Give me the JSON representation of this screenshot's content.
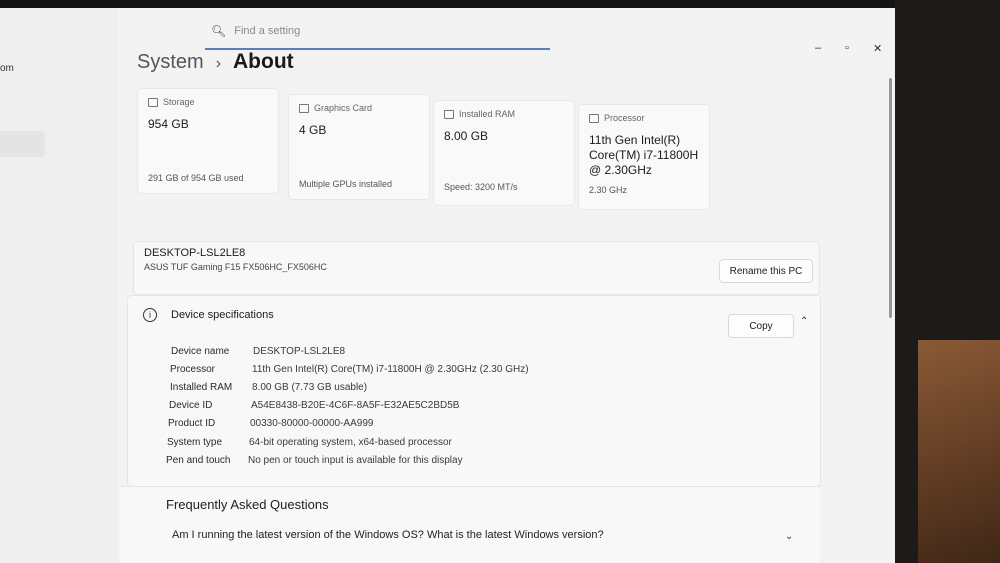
{
  "left_pane": {
    "fragment": "om"
  },
  "search": {
    "placeholder": "Find a setting"
  },
  "window_controls": {
    "minimize": "–",
    "restore": "▫",
    "close": "✕"
  },
  "header": {
    "crumb": "System",
    "separator": "›",
    "current": "About"
  },
  "cards": {
    "storage": {
      "label": "Storage",
      "value": "954 GB",
      "sub": "291 GB of 954 GB used"
    },
    "graphics": {
      "label": "Graphics Card",
      "value": "4 GB",
      "sub": "Multiple GPUs installed"
    },
    "ram": {
      "label": "Installed RAM",
      "value": "8.00 GB",
      "sub": "Speed: 3200 MT/s"
    },
    "processor": {
      "label": "Processor",
      "value": "11th Gen Intel(R) Core(TM) i7-11800H @ 2.30GHz",
      "sub": "2.30 GHz"
    }
  },
  "pc": {
    "name": "DESKTOP-LSL2LE8",
    "model": "ASUS TUF Gaming F15 FX506HC_FX506HC",
    "rename_label": "Rename this PC"
  },
  "specs": {
    "title": "Device specifications",
    "copy_label": "Copy",
    "rows": [
      {
        "key": "Device name",
        "value": "DESKTOP-LSL2LE8"
      },
      {
        "key": "Processor",
        "value": "11th Gen Intel(R) Core(TM) i7-11800H @ 2.30GHz (2.30 GHz)"
      },
      {
        "key": "Installed RAM",
        "value": "8.00 GB (7.73 GB usable)"
      },
      {
        "key": "Device ID",
        "value": "A54E8438-B20E-4C6F-8A5F-E32AE5C2BD5B"
      },
      {
        "key": "Product ID",
        "value": "00330-80000-00000-AA999"
      },
      {
        "key": "System type",
        "value": "64-bit operating system, x64-based processor"
      },
      {
        "key": "Pen and touch",
        "value": "No pen or touch input is available for this display"
      }
    ]
  },
  "faq": {
    "title": "Frequently Asked Questions",
    "question": "Am I running the latest version of the Windows OS? What is the latest Windows version?"
  },
  "icons": [
    "search-icon",
    "storage-icon",
    "gpu-icon",
    "ram-icon",
    "processor-icon",
    "info-icon",
    "chevron-up-icon",
    "chevron-down-icon"
  ]
}
